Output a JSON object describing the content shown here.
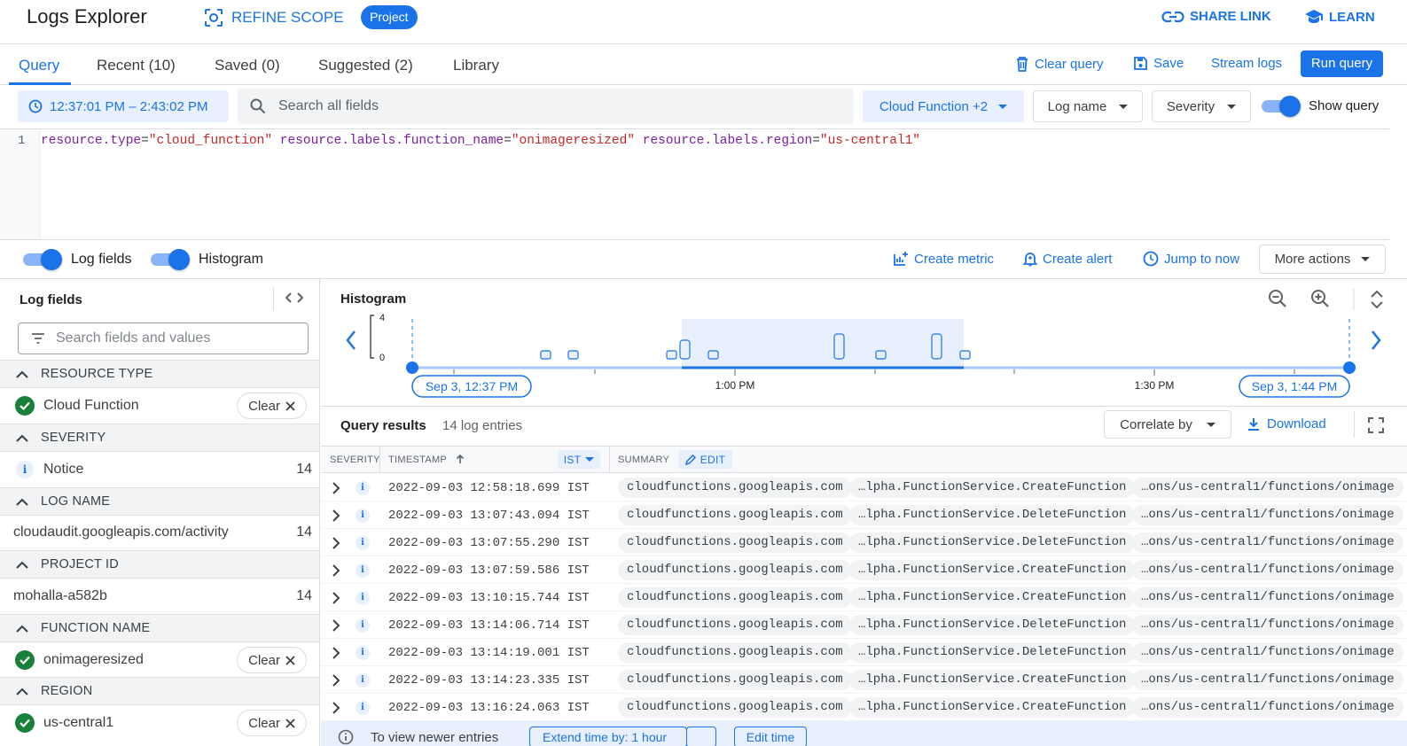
{
  "app": {
    "title": "Logs Explorer",
    "refine_scope": "REFINE SCOPE",
    "project_chip": "Project",
    "share_link": "SHARE LINK",
    "learn": "LEARN",
    "accent_color": "#1a73e8"
  },
  "tabs": [
    {
      "label": "Query",
      "active": true
    },
    {
      "label": "Recent (10)"
    },
    {
      "label": "Saved (0)"
    },
    {
      "label": "Suggested (2)"
    },
    {
      "label": "Library"
    }
  ],
  "toolbar": {
    "clear_query": "Clear query",
    "save": "Save",
    "stream_logs": "Stream logs",
    "run_query": "Run query"
  },
  "filters": {
    "time_range": "12:37:01 PM – 2:43:02 PM",
    "search_placeholder": "Search all fields",
    "resource": "Cloud Function +2",
    "log_name": "Log name",
    "severity": "Severity",
    "show_query": "Show query",
    "show_query_on": true
  },
  "editor": {
    "line_number": "1",
    "query": [
      {
        "k": "resource.type",
        "v": "\"cloud_function\""
      },
      {
        "k": "resource.labels.function_name",
        "v": "\"onimageresized\""
      },
      {
        "k": "resource.labels.region",
        "v": "\"us-central1\""
      }
    ]
  },
  "options": {
    "log_fields": "Log fields",
    "histogram": "Histogram",
    "create_metric": "Create metric",
    "create_alert": "Create alert",
    "jump_to_now": "Jump to now",
    "more_actions": "More actions"
  },
  "log_fields_panel": {
    "title": "Log fields",
    "search_placeholder": "Search fields and values",
    "sections": [
      {
        "header": "RESOURCE TYPE",
        "value": "Cloud Function",
        "selected": true,
        "clear": "Clear"
      },
      {
        "header": "SEVERITY",
        "value": "Notice",
        "count": "14",
        "severity_icon": true
      },
      {
        "header": "LOG NAME",
        "value": "cloudaudit.googleapis.com/activity",
        "count": "14"
      },
      {
        "header": "PROJECT ID",
        "value": "mohalla-a582b",
        "count": "14"
      },
      {
        "header": "FUNCTION NAME",
        "value": "onimageresized",
        "selected": true,
        "clear": "Clear"
      },
      {
        "header": "REGION",
        "value": "us-central1",
        "selected": true,
        "clear": "Clear"
      }
    ]
  },
  "histogram": {
    "title": "Histogram",
    "y_max": "4",
    "y_min": "0",
    "start_label": "Sep 3, 12:37 PM",
    "end_label": "Sep 3, 1:44 PM",
    "tick_1": "1:00 PM",
    "tick_2": "1:30 PM"
  },
  "results": {
    "title": "Query results",
    "count": "14 log entries",
    "correlate": "Correlate by",
    "download": "Download",
    "col_severity": "SEVERITY",
    "col_timestamp": "TIMESTAMP",
    "timezone": "IST",
    "col_summary": "SUMMARY",
    "edit": "EDIT",
    "rows": [
      {
        "ts": "2022-09-03 12:58:18.699 IST",
        "service": "cloudfunctions.googleapis.com",
        "method": "…lpha.FunctionService.CreateFunction",
        "resource": "…ons/us-central1/functions/onimage"
      },
      {
        "ts": "2022-09-03 13:07:43.094 IST",
        "service": "cloudfunctions.googleapis.com",
        "method": "…lpha.FunctionService.DeleteFunction",
        "resource": "…ons/us-central1/functions/onimage"
      },
      {
        "ts": "2022-09-03 13:07:55.290 IST",
        "service": "cloudfunctions.googleapis.com",
        "method": "…lpha.FunctionService.DeleteFunction",
        "resource": "…ons/us-central1/functions/onimage"
      },
      {
        "ts": "2022-09-03 13:07:59.586 IST",
        "service": "cloudfunctions.googleapis.com",
        "method": "…lpha.FunctionService.CreateFunction",
        "resource": "…ons/us-central1/functions/onimage"
      },
      {
        "ts": "2022-09-03 13:10:15.744 IST",
        "service": "cloudfunctions.googleapis.com",
        "method": "…lpha.FunctionService.CreateFunction",
        "resource": "…ons/us-central1/functions/onimage"
      },
      {
        "ts": "2022-09-03 13:14:06.714 IST",
        "service": "cloudfunctions.googleapis.com",
        "method": "…lpha.FunctionService.DeleteFunction",
        "resource": "…ons/us-central1/functions/onimage"
      },
      {
        "ts": "2022-09-03 13:14:19.001 IST",
        "service": "cloudfunctions.googleapis.com",
        "method": "…lpha.FunctionService.DeleteFunction",
        "resource": "…ons/us-central1/functions/onimage"
      },
      {
        "ts": "2022-09-03 13:14:23.335 IST",
        "service": "cloudfunctions.googleapis.com",
        "method": "…lpha.FunctionService.CreateFunction",
        "resource": "…ons/us-central1/functions/onimage"
      },
      {
        "ts": "2022-09-03 13:16:24.063 IST",
        "service": "cloudfunctions.googleapis.com",
        "method": "…lpha.FunctionService.CreateFunction",
        "resource": "…ons/us-central1/functions/onimage"
      }
    ]
  },
  "footer": {
    "text": "To view newer entries",
    "extend": "Extend time by: 1 hour",
    "edit_time": "Edit time"
  }
}
